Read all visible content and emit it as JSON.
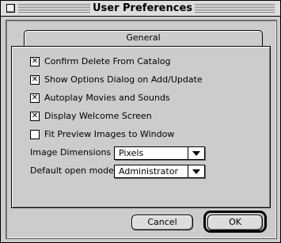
{
  "window": {
    "title": "User Preferences"
  },
  "tab": {
    "label": "General"
  },
  "options": [
    {
      "label": "Confirm Delete From Catalog",
      "checked": true
    },
    {
      "label": "Show Options Dialog on Add/Update",
      "checked": true
    },
    {
      "label": "Autoplay Movies and Sounds",
      "checked": true
    },
    {
      "label": "Display Welcome Screen",
      "checked": true
    },
    {
      "label": "Fit Preview Images to Window",
      "checked": false
    }
  ],
  "image_dimensions": {
    "label": "Image Dimensions :",
    "value": "Pixels"
  },
  "default_open_mode": {
    "label": "Default open mode :",
    "value": "Administrator"
  },
  "buttons": {
    "cancel": "Cancel",
    "ok": "OK"
  }
}
